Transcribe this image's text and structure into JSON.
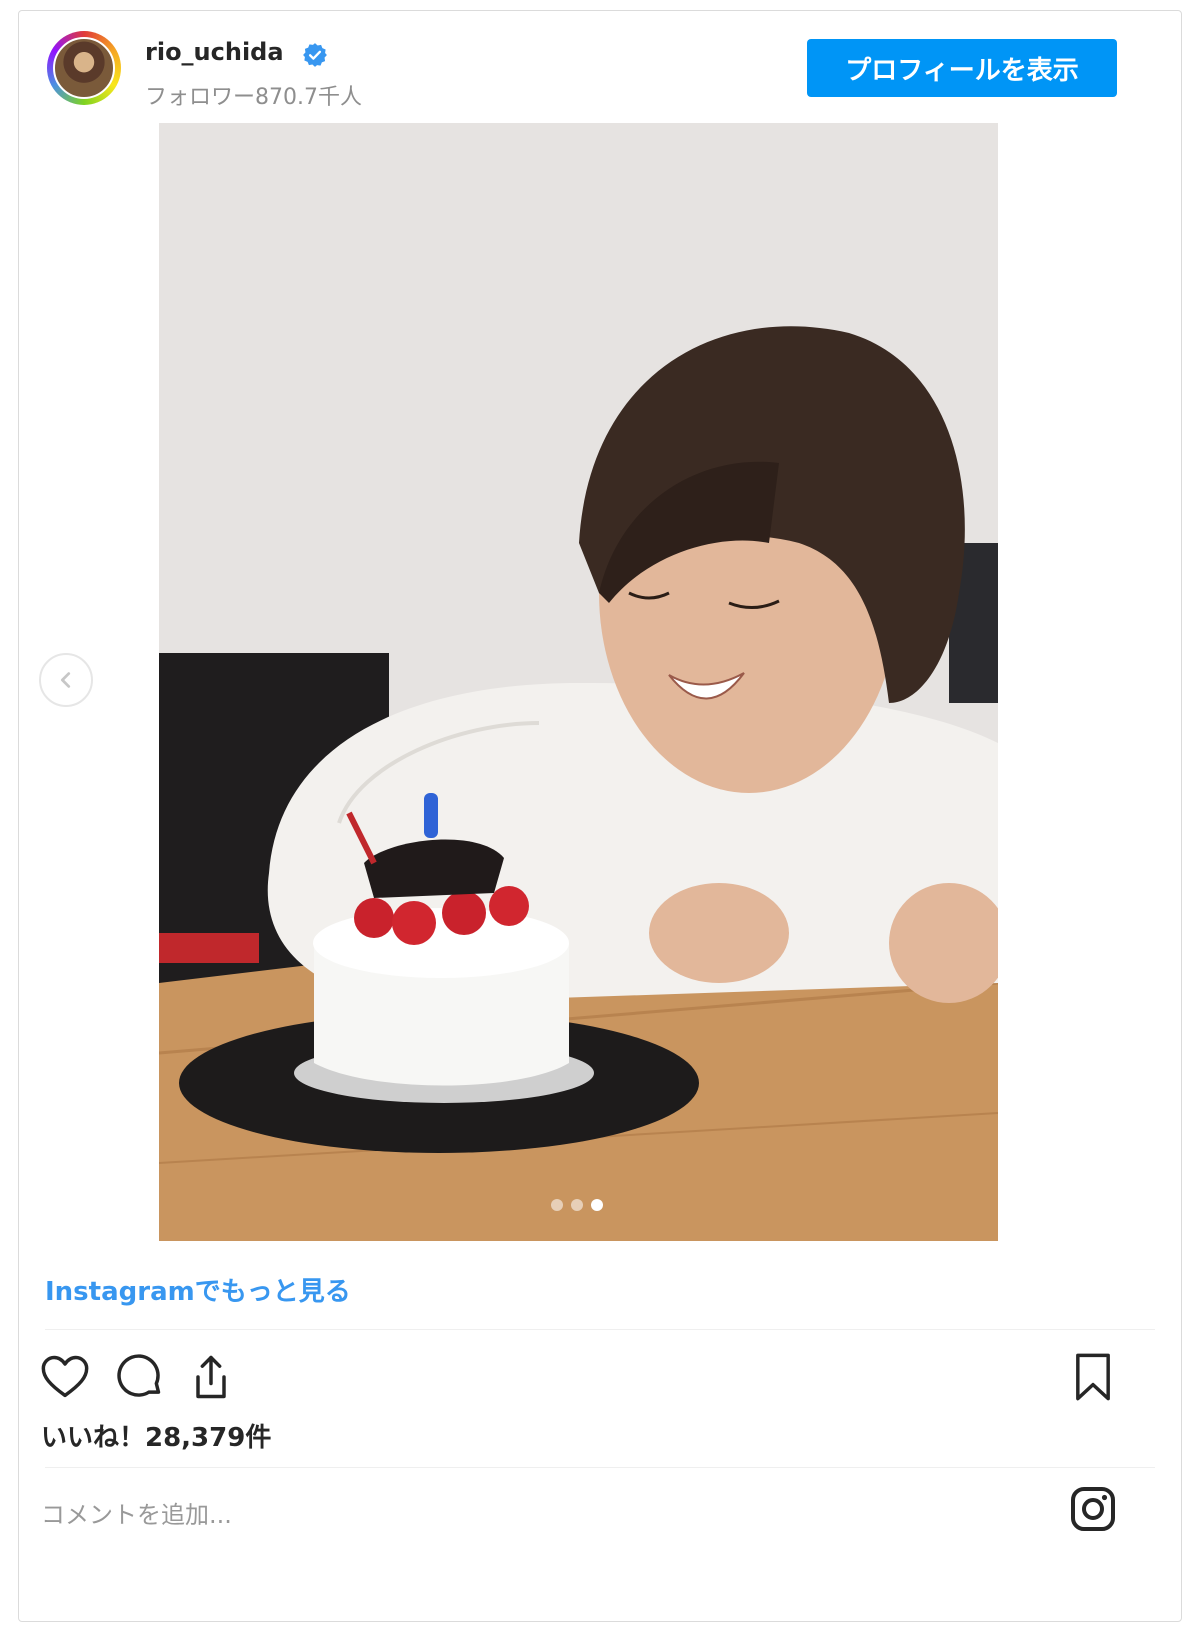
{
  "header": {
    "username": "rio_uchida",
    "followers": "フォロワー870.7千人",
    "profile_button": "プロフィールを表示"
  },
  "post": {
    "more_link": "Instagramでもっと見る",
    "likes": "いいね！28,379件",
    "comment_placeholder": "コメントを追加...",
    "carousel": {
      "count": 3,
      "active_index": 3
    }
  },
  "colors": {
    "accent": "#0095f6",
    "link": "#3897f0"
  },
  "icons": {
    "avatar": "avatar",
    "verified": "verified-badge-icon",
    "prev": "chevron-left-icon",
    "like": "heart-icon",
    "comment": "comment-icon",
    "share": "share-icon",
    "save": "bookmark-icon",
    "brand": "instagram-icon"
  }
}
